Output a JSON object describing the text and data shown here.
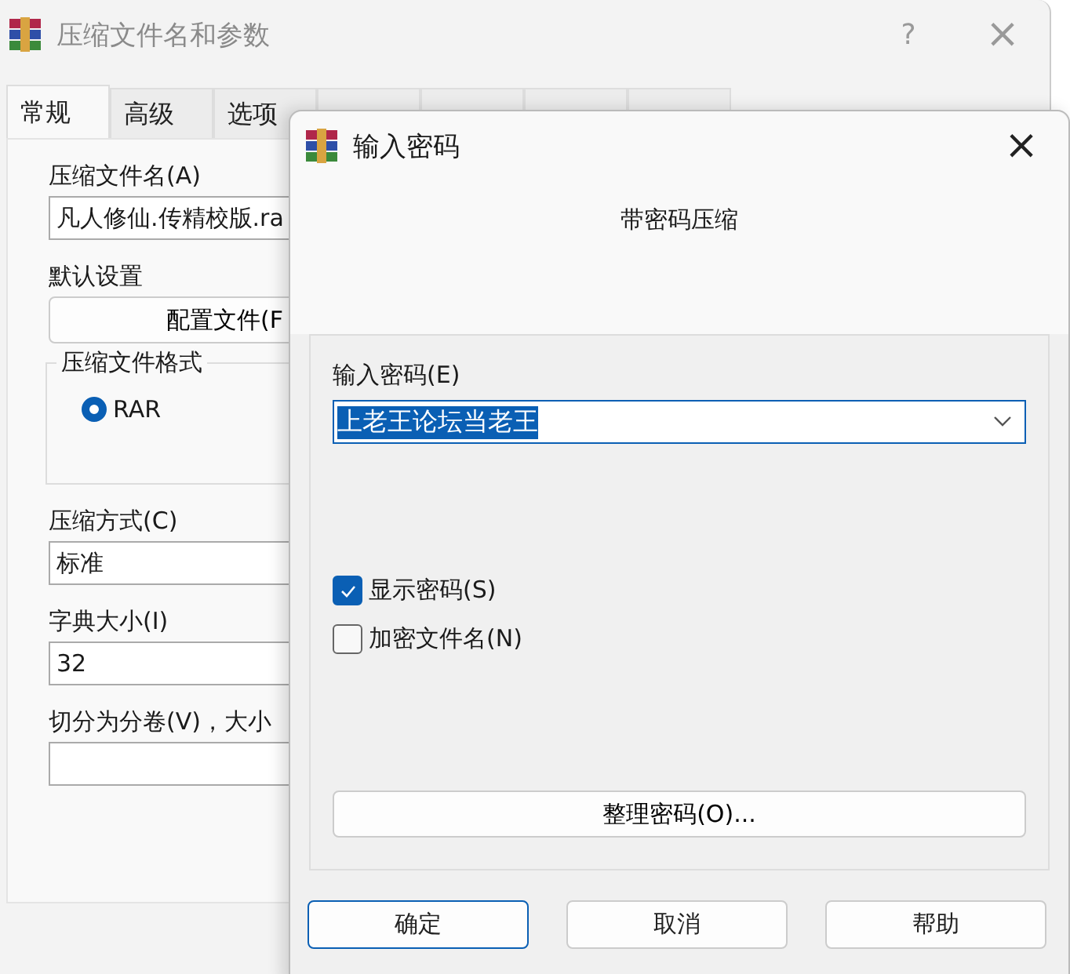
{
  "main_window": {
    "title": "压缩文件名和参数",
    "help": "?",
    "close": "×",
    "tabs": [
      {
        "label": "常规",
        "selected": true
      },
      {
        "label": "高级",
        "selected": false
      },
      {
        "label": "选项",
        "selected": false
      }
    ],
    "covered_tabs": [
      {
        "selected": false
      },
      {
        "selected": false
      },
      {
        "selected": false
      },
      {
        "selected": false
      }
    ],
    "archive_name": {
      "label": "压缩文件名(A)",
      "value": "凡人修仙.传精校版.ra"
    },
    "defaults": {
      "label": "默认设置",
      "button": "配置文件(F"
    },
    "format": {
      "label": "压缩文件格式",
      "options": [
        {
          "label": "RAR",
          "selected": true
        }
      ]
    },
    "method": {
      "label": "压缩方式(C)",
      "value": "标准"
    },
    "dictionary": {
      "label": "字典大小(I)",
      "value": "32"
    },
    "split": {
      "label": "切分为分卷(V)，大小"
    }
  },
  "dialog": {
    "title": "输入密码",
    "close": "×",
    "heading": "带密码压缩",
    "password": {
      "label": "输入密码(E)",
      "value": "上老王论坛当老王"
    },
    "checkboxes": [
      {
        "label": "显示密码(S)",
        "checked": true
      },
      {
        "label": "加密文件名(N)",
        "checked": false
      }
    ],
    "organize_button": "整理密码(O)...",
    "buttons": [
      {
        "label": "确定",
        "selected": true
      },
      {
        "label": "取消",
        "selected": false
      },
      {
        "label": "帮助",
        "selected": false
      }
    ]
  }
}
